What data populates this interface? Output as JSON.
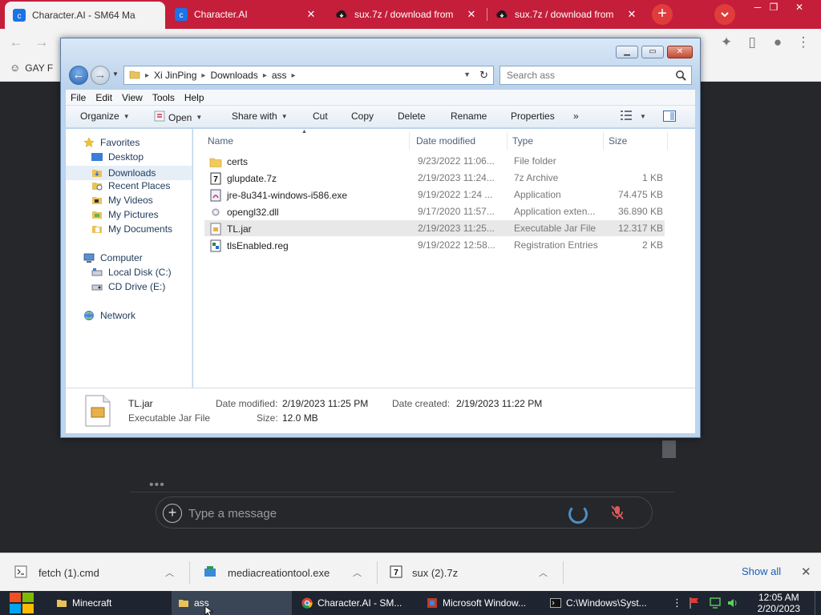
{
  "browser": {
    "tabs": [
      {
        "title": "Character.AI - SM64 Ma",
        "active": true
      },
      {
        "title": "Character.AI",
        "active": false
      },
      {
        "title": "sux.7z / download from",
        "active": false
      },
      {
        "title": "sux.7z / download from",
        "active": false
      }
    ],
    "new_tab": "+",
    "bookmark": "GAY F"
  },
  "chat": {
    "typing_indicator": "•••",
    "placeholder": "Type a message"
  },
  "explorer": {
    "breadcrumb": [
      "Xi JinPing",
      "Downloads",
      "ass"
    ],
    "search_placeholder": "Search ass",
    "menu": [
      "File",
      "Edit",
      "View",
      "Tools",
      "Help"
    ],
    "commands": {
      "organize": "Organize",
      "open": "Open",
      "share": "Share with",
      "cut": "Cut",
      "copy": "Copy",
      "delete": "Delete",
      "rename": "Rename",
      "properties": "Properties",
      "more": "»"
    },
    "nav": {
      "favorites": "Favorites",
      "desktop": "Desktop",
      "downloads": "Downloads",
      "recent": "Recent Places",
      "videos": "My Videos",
      "pictures": "My Pictures",
      "documents": "My Documents",
      "computer": "Computer",
      "local_disk": "Local Disk (C:)",
      "cd_drive": "CD Drive (E:)",
      "network": "Network"
    },
    "columns": {
      "name": "Name",
      "date": "Date modified",
      "type": "Type",
      "size": "Size"
    },
    "files": [
      {
        "name": "certs",
        "date": "9/23/2022 11:06...",
        "type": "File folder",
        "size": "",
        "icon": "folder-icon"
      },
      {
        "name": "glupdate.7z",
        "date": "2/19/2023 11:24...",
        "type": "7z Archive",
        "size": "1 KB",
        "icon": "archive-icon"
      },
      {
        "name": "jre-8u341-windows-i586.exe",
        "date": "9/19/2022 1:24 ...",
        "type": "Application",
        "size": "74.475 KB",
        "icon": "exe-icon"
      },
      {
        "name": "opengl32.dll",
        "date": "9/17/2020 11:57...",
        "type": "Application exten...",
        "size": "36.890 KB",
        "icon": "dll-icon"
      },
      {
        "name": "TL.jar",
        "date": "2/19/2023 11:25...",
        "type": "Executable Jar File",
        "size": "12.317 KB",
        "icon": "jar-icon"
      },
      {
        "name": "tlsEnabled.reg",
        "date": "9/19/2022 12:58...",
        "type": "Registration Entries",
        "size": "2 KB",
        "icon": "reg-icon"
      }
    ],
    "details": {
      "name": "TL.jar",
      "type": "Executable Jar File",
      "date_modified_label": "Date modified:",
      "date_modified": "2/19/2023 11:25 PM",
      "date_created_label": "Date created:",
      "date_created": "2/19/2023 11:22 PM",
      "size_label": "Size:",
      "size": "12.0 MB"
    }
  },
  "downloads": {
    "items": [
      "fetch (1).cmd",
      "mediacreationtool.exe",
      "sux (2).7z"
    ],
    "show_all": "Show all",
    "close": "✕"
  },
  "taskbar": {
    "items": [
      "Minecraft",
      "ass",
      "Character.AI - SM...",
      "Microsoft Window...",
      "C:\\Windows\\Syst..."
    ],
    "time": "12:05 AM",
    "date": "2/20/2023"
  },
  "colors": {
    "tabstrip": "#c41e3a",
    "accent_blue": "#4a90c8",
    "taskbar": "#1e2530"
  }
}
